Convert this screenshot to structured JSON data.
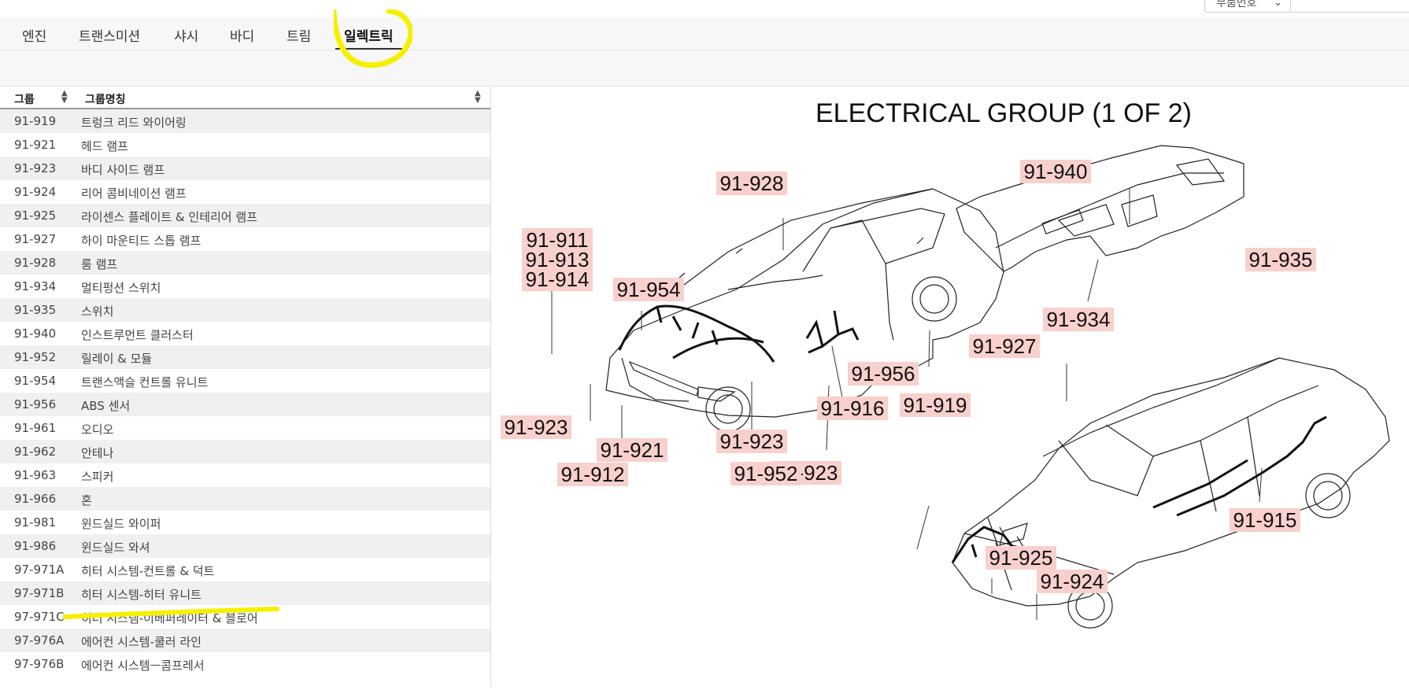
{
  "topbar": {
    "part_select_label": "부품번호"
  },
  "tabs": [
    {
      "label": "엔진"
    },
    {
      "label": "트랜스미션"
    },
    {
      "label": "샤시"
    },
    {
      "label": "바디"
    },
    {
      "label": "트림"
    },
    {
      "label": "일렉트릭",
      "active": true
    }
  ],
  "list": {
    "col_group": "그룹",
    "col_name": "그룹명칭",
    "rows": [
      {
        "code": "91-919",
        "name": "트렁크 리드 와이어링"
      },
      {
        "code": "91-921",
        "name": "헤드 램프"
      },
      {
        "code": "91-923",
        "name": "바디 사이드 램프"
      },
      {
        "code": "91-924",
        "name": "리어 콤비네이션 램프"
      },
      {
        "code": "91-925",
        "name": "라이센스 플레이트 & 인테리어 램프"
      },
      {
        "code": "91-927",
        "name": "하이 마운티드 스톱 램프"
      },
      {
        "code": "91-928",
        "name": "룸 램프"
      },
      {
        "code": "91-934",
        "name": "멀티펑션 스위치"
      },
      {
        "code": "91-935",
        "name": "스위치"
      },
      {
        "code": "91-940",
        "name": "인스트루먼트 클러스터"
      },
      {
        "code": "91-952",
        "name": "릴레이 & 모듈"
      },
      {
        "code": "91-954",
        "name": "트랜스액슬 컨트롤 유니트"
      },
      {
        "code": "91-956",
        "name": "ABS 센서"
      },
      {
        "code": "91-961",
        "name": "오디오"
      },
      {
        "code": "91-962",
        "name": "안테나"
      },
      {
        "code": "91-963",
        "name": "스피커"
      },
      {
        "code": "91-966",
        "name": "혼"
      },
      {
        "code": "91-981",
        "name": "윈드실드 와이퍼"
      },
      {
        "code": "91-986",
        "name": "윈드실드 와셔"
      },
      {
        "code": "97-971A",
        "name": "히터 시스템-컨트롤 & 덕트"
      },
      {
        "code": "97-971B",
        "name": "히터 시스템-히터 유니트"
      },
      {
        "code": "97-971C",
        "name": "히터 시스템-이베퍼레이터 & 블로어"
      },
      {
        "code": "97-976A",
        "name": "에어컨 시스템-쿨러 라인"
      },
      {
        "code": "97-976B",
        "name": "에어컨 시스템ㅡ콤프레서"
      }
    ]
  },
  "diagram": {
    "title": "ELECTRICAL GROUP (1 OF 2)",
    "callouts": [
      "91-928",
      "91-940",
      "91-911",
      "91-913",
      "91-914",
      "91-954",
      "91-935",
      "91-934",
      "91-927",
      "91-956",
      "91-919",
      "91-916",
      "91-923",
      "91-923",
      "91-921",
      "91-923",
      "91-912",
      "91-952",
      "91-915",
      "91-925",
      "91-924"
    ],
    "callout_color": "#f8d0cc",
    "highlight_color": "#f5f000"
  }
}
